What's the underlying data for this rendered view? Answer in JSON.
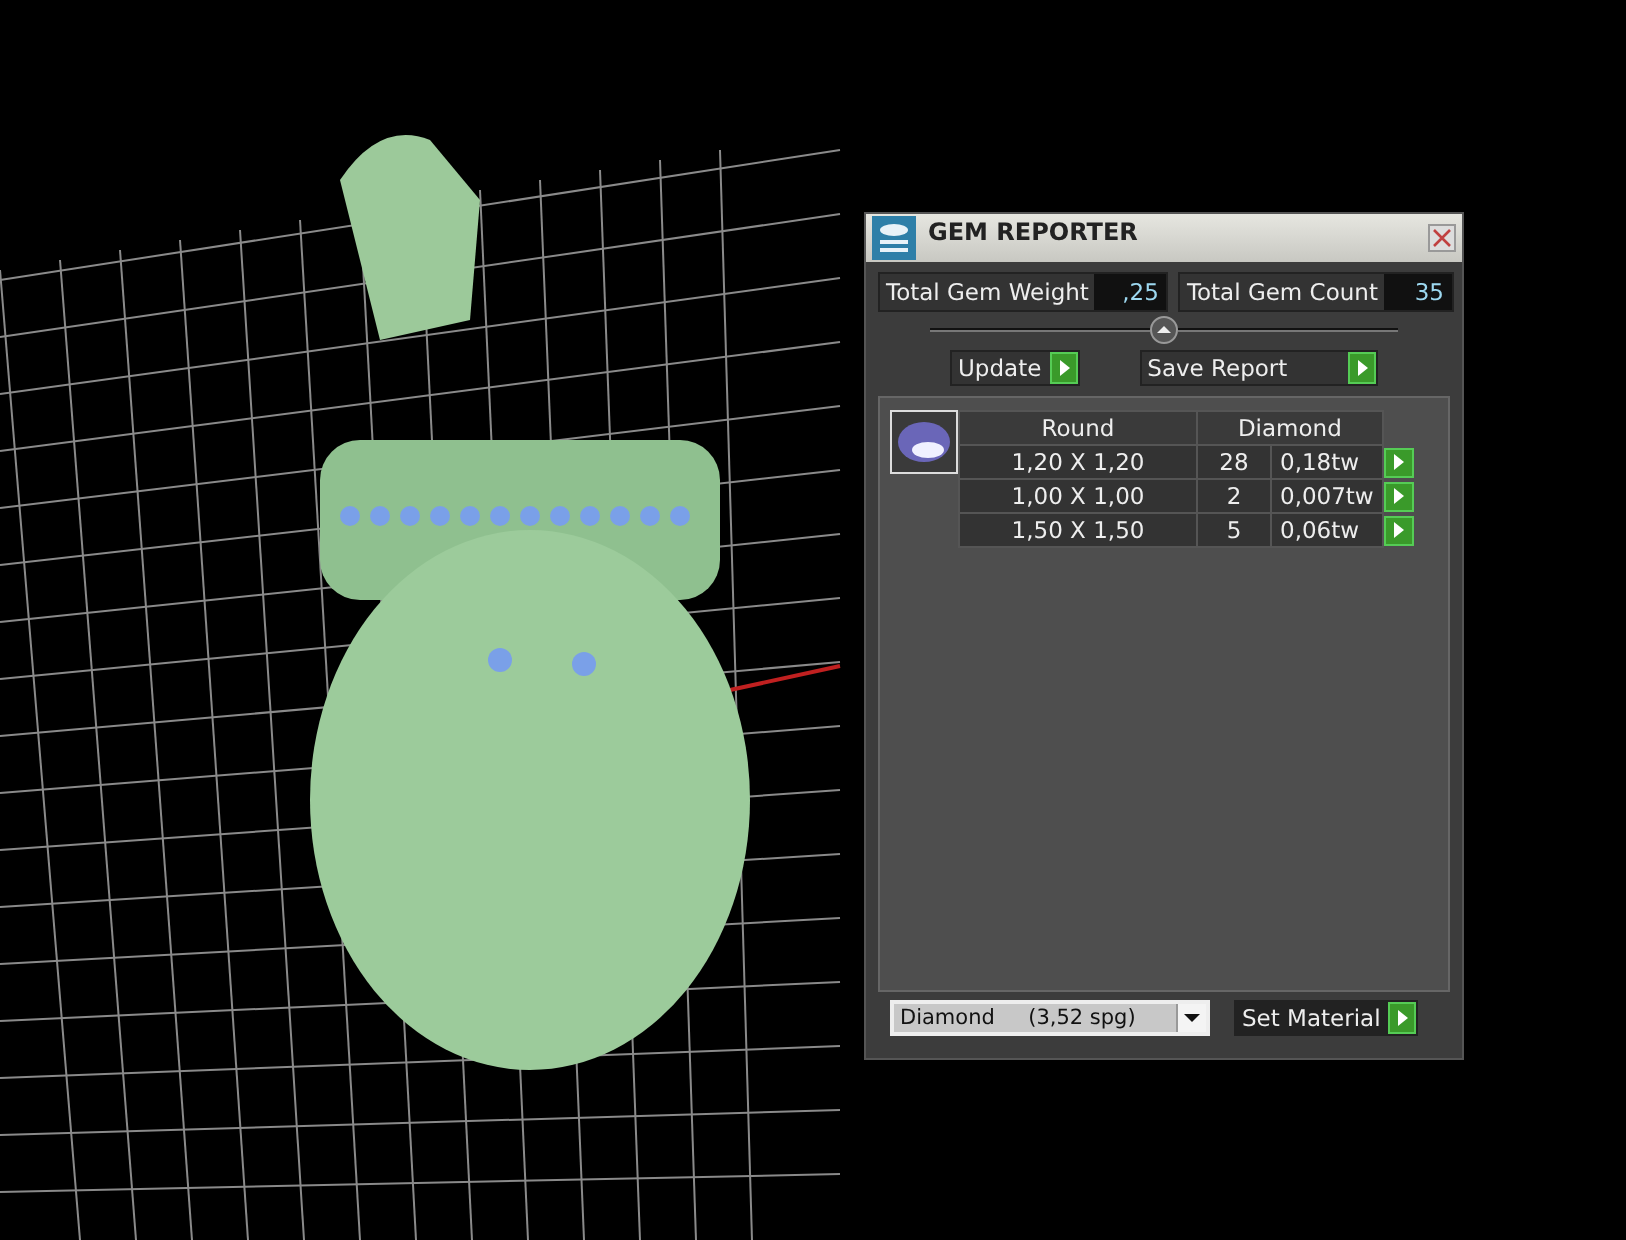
{
  "panel": {
    "title": "GEM REPORTER",
    "weight_label": "Total Gem Weight",
    "weight_value": ",25",
    "count_label": "Total Gem Count",
    "count_value": "35",
    "update_button": "Update",
    "save_button": "Save Report",
    "table": {
      "shape": "Round",
      "material": "Diamond",
      "rows": [
        {
          "size": "1,20 X 1,20",
          "count": "28",
          "weight": "0,18tw"
        },
        {
          "size": "1,00 X 1,00",
          "count": "2",
          "weight": "0,007tw"
        },
        {
          "size": "1,50 X 1,50",
          "count": "5",
          "weight": "0,06tw"
        }
      ]
    },
    "material_select": {
      "value": "Diamond     (3,52 spg)"
    },
    "set_material_button": "Set Material"
  }
}
